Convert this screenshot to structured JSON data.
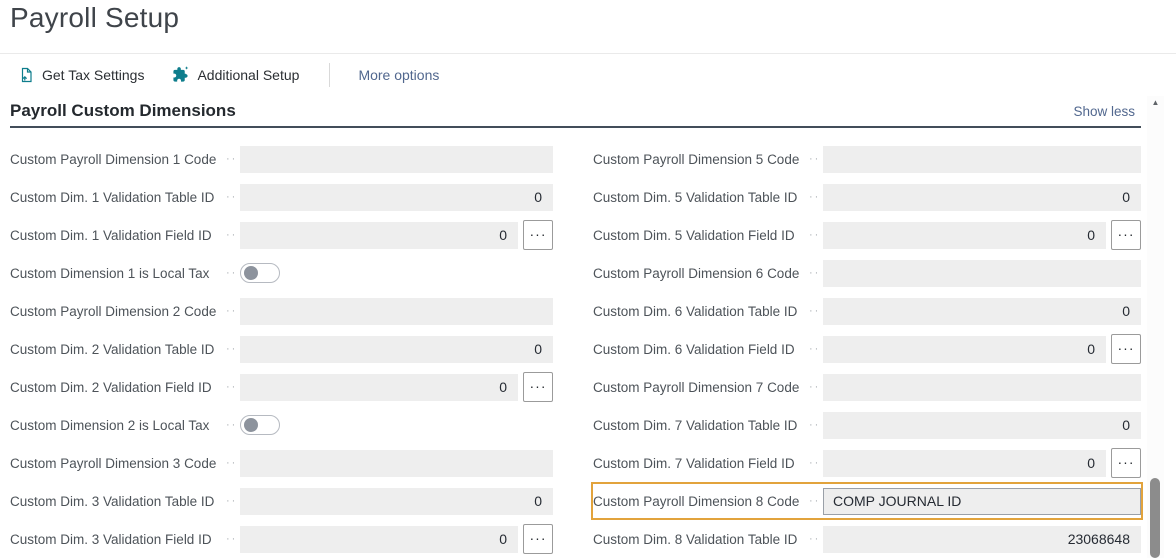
{
  "page_title": "Payroll Setup",
  "toolbar": {
    "actions": [
      {
        "label": "Get Tax Settings",
        "icon": "export-document-icon"
      },
      {
        "label": "Additional Setup",
        "icon": "puzzle-icon"
      }
    ],
    "more_options": "More options"
  },
  "section": {
    "title": "Payroll Custom Dimensions",
    "show_less": "Show less"
  },
  "icons": {
    "label_leader": "··",
    "assist_edit": "···",
    "scroll_up": "▲"
  },
  "colors": {
    "accent_teal": "#0e7d8c",
    "highlight_border": "#e2a33c",
    "field_background": "#eeeeee",
    "link_text": "#51678e",
    "section_rule": "#434e5a"
  },
  "form": {
    "left_column": [
      {
        "label": "Custom Payroll Dimension 1 Code",
        "type": "text",
        "value": ""
      },
      {
        "label": "Custom Dim. 1 Validation Table ID",
        "type": "number",
        "value": "0"
      },
      {
        "label": "Custom Dim. 1 Validation Field ID",
        "type": "number",
        "value": "0",
        "assist_edit": true
      },
      {
        "label": "Custom Dimension 1 is Local Tax",
        "type": "toggle",
        "value": "off"
      },
      {
        "label": "Custom Payroll Dimension 2 Code",
        "type": "text",
        "value": ""
      },
      {
        "label": "Custom Dim. 2 Validation Table ID",
        "type": "number",
        "value": "0"
      },
      {
        "label": "Custom Dim. 2 Validation Field ID",
        "type": "number",
        "value": "0",
        "assist_edit": true
      },
      {
        "label": "Custom Dimension 2 is Local Tax",
        "type": "toggle",
        "value": "off"
      },
      {
        "label": "Custom Payroll Dimension 3 Code",
        "type": "text",
        "value": ""
      },
      {
        "label": "Custom Dim. 3 Validation Table ID",
        "type": "number",
        "value": "0"
      },
      {
        "label": "Custom Dim. 3 Validation Field ID",
        "type": "number",
        "value": "0",
        "assist_edit": true
      }
    ],
    "right_column": [
      {
        "label": "Custom Payroll Dimension 5 Code",
        "type": "text",
        "value": ""
      },
      {
        "label": "Custom Dim. 5 Validation Table ID",
        "type": "number",
        "value": "0"
      },
      {
        "label": "Custom Dim. 5 Validation Field ID",
        "type": "number",
        "value": "0",
        "assist_edit": true
      },
      {
        "label": "Custom Payroll Dimension 6 Code",
        "type": "text",
        "value": ""
      },
      {
        "label": "Custom Dim. 6 Validation Table ID",
        "type": "number",
        "value": "0"
      },
      {
        "label": "Custom Dim. 6 Validation Field ID",
        "type": "number",
        "value": "0",
        "assist_edit": true
      },
      {
        "label": "Custom Payroll Dimension 7 Code",
        "type": "text",
        "value": ""
      },
      {
        "label": "Custom Dim. 7 Validation Table ID",
        "type": "number",
        "value": "0"
      },
      {
        "label": "Custom Dim. 7 Validation Field ID",
        "type": "number",
        "value": "0",
        "assist_edit": true
      },
      {
        "label": "Custom Payroll Dimension 8 Code",
        "type": "text",
        "value": "COMP JOURNAL ID",
        "highlighted": true
      },
      {
        "label": "Custom Dim. 8 Validation Table ID",
        "type": "number",
        "value": "23068648"
      }
    ]
  }
}
